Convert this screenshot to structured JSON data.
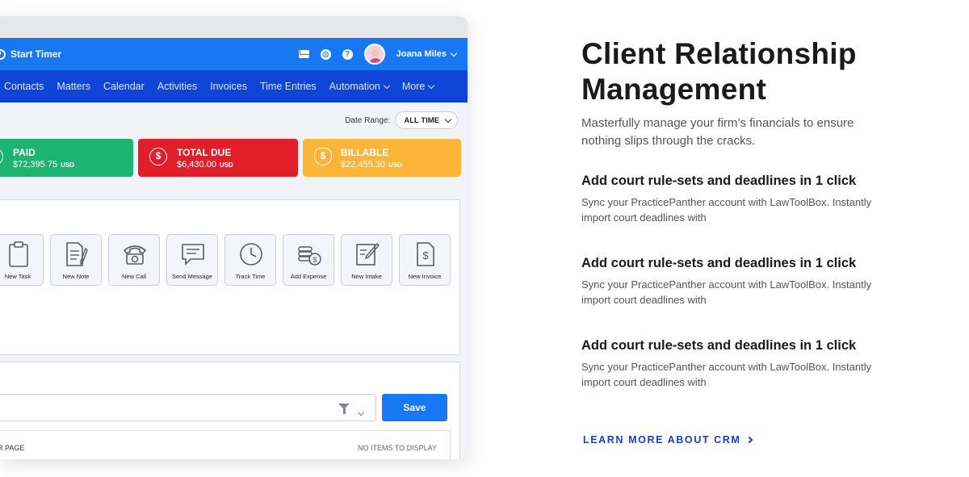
{
  "app": {
    "start_timer": "Start Timer",
    "user_name": "Joana Miles",
    "nav": [
      "Contacts",
      "Matters",
      "Calendar",
      "Activities",
      "Invoices",
      "Time Entries",
      "Automation",
      "More"
    ],
    "date_range_label": "Date Range:",
    "date_range_value": "ALL TIME",
    "cards": {
      "paid": {
        "title": "PAID",
        "amount": "$72,395.75",
        "currency": "USD",
        "color": "#1db471"
      },
      "due": {
        "title": "TOTAL DUE",
        "amount": "$6,430.00",
        "currency": "USD",
        "color": "#e21e2a"
      },
      "billable": {
        "title": "BILLABLE",
        "amount": "$22,455.30",
        "currency": "USD",
        "color": "#fbb63a"
      }
    },
    "quick_actions": [
      {
        "label": "New Task",
        "icon": "clipboard-icon"
      },
      {
        "label": "New Note",
        "icon": "note-icon"
      },
      {
        "label": "New Call",
        "icon": "phone-icon"
      },
      {
        "label": "Send Message",
        "icon": "message-icon"
      },
      {
        "label": "Track Time",
        "icon": "clock-icon"
      },
      {
        "label": "Add Expense",
        "icon": "coins-icon"
      },
      {
        "label": "New Intake",
        "icon": "intake-icon"
      },
      {
        "label": "New Invoice",
        "icon": "invoice-icon"
      }
    ],
    "save_label": "Save",
    "per_page": "R PAGE",
    "no_items": "NO ITEMS TO DISPLAY",
    "colors": {
      "topbar": "#1877f2",
      "navbar": "#0e45d6"
    }
  },
  "marketing": {
    "heading_line1": "Client Relationship",
    "heading_line2": "Management",
    "subtitle": "Masterfully manage your firm’s financials to ensure nothing slips through the cracks.",
    "features": [
      {
        "title": "Add court rule-sets and deadlines in 1 click",
        "desc": "Sync your PracticePanther account with LawToolBox. Instantly import court deadlines with"
      },
      {
        "title": "Add court rule-sets and deadlines in 1 click",
        "desc": "Sync your PracticePanther account with LawToolBox. Instantly import court deadlines with"
      },
      {
        "title": "Add court rule-sets and deadlines in 1 click",
        "desc": "Sync your PracticePanther account with LawToolBox. Instantly import court deadlines with"
      }
    ],
    "learn_more": "LEARN MORE ABOUT CRM",
    "link_color": "#1a3fc7"
  }
}
